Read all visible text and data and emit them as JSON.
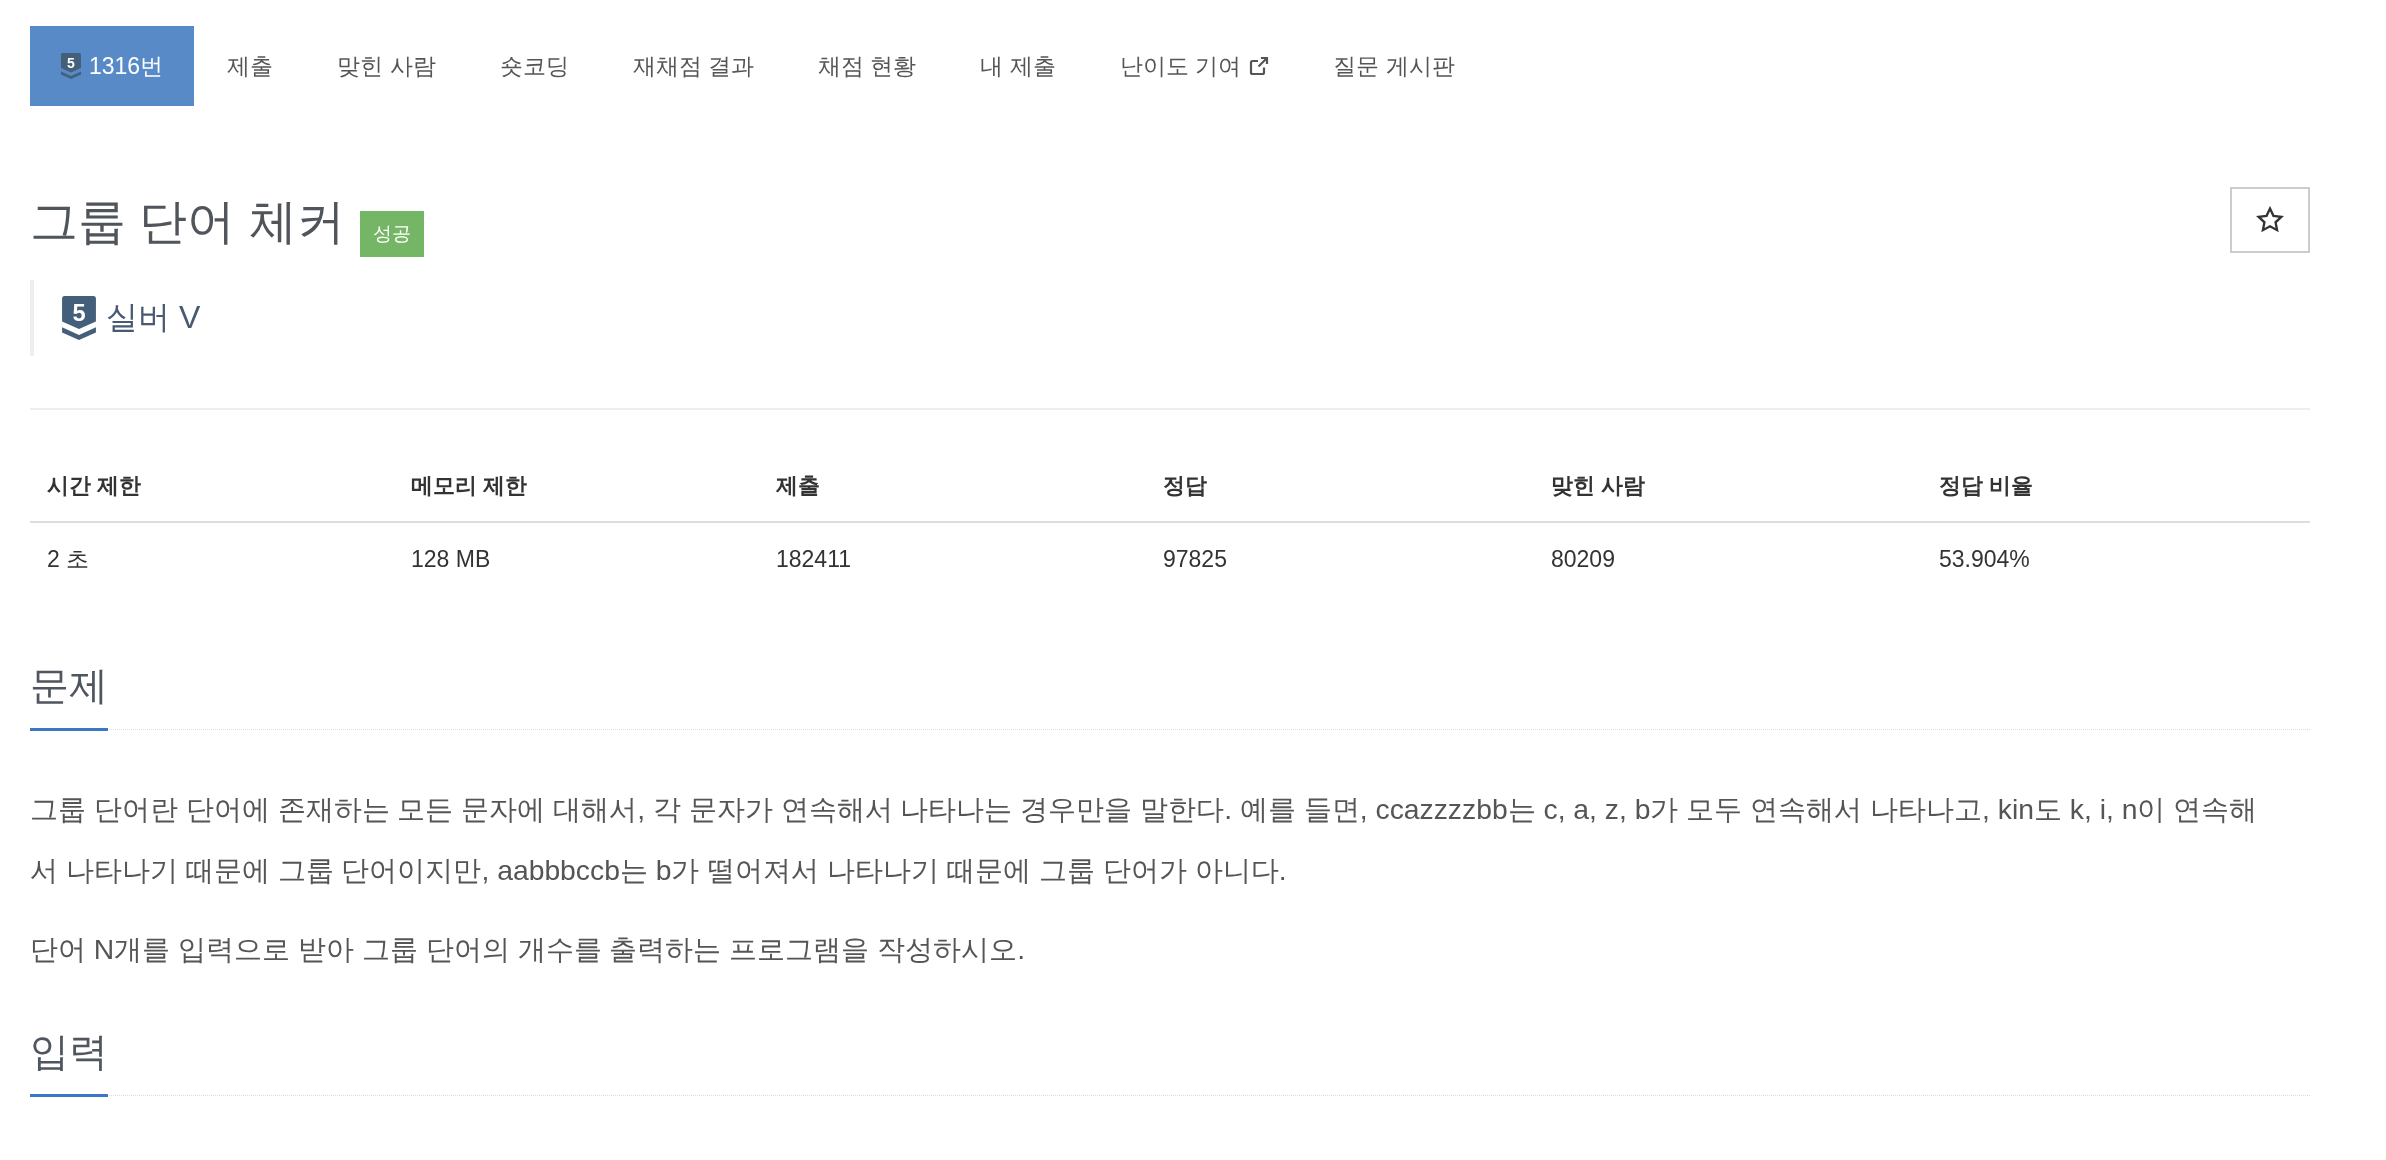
{
  "nav": {
    "tabs": [
      {
        "label": "1316번",
        "tier": "5",
        "external": false,
        "selected": true
      },
      {
        "label": "제출",
        "external": false,
        "selected": false
      },
      {
        "label": "맞힌 사람",
        "external": false,
        "selected": false
      },
      {
        "label": "숏코딩",
        "external": false,
        "selected": false
      },
      {
        "label": "재채점 결과",
        "external": false,
        "selected": false
      },
      {
        "label": "채점 현황",
        "external": false,
        "selected": false
      },
      {
        "label": "내 제출",
        "external": false,
        "selected": false
      },
      {
        "label": "난이도 기여",
        "external": true,
        "selected": false
      },
      {
        "label": "질문 게시판",
        "external": false,
        "selected": false
      }
    ]
  },
  "problem": {
    "title": "그룹 단어 체커",
    "result": {
      "label": "성공",
      "kind": "success"
    },
    "starred": false,
    "tier": {
      "level": "5",
      "name": "실버 V"
    }
  },
  "info_table": {
    "columns": [
      "시간 제한",
      "메모리 제한",
      "제출",
      "정답",
      "맞힌 사람",
      "정답 비율"
    ],
    "rows": [
      [
        "2 초",
        "128 MB",
        "182411",
        "97825",
        "80209",
        "53.904%"
      ]
    ]
  },
  "sections": [
    {
      "heading": "문제",
      "paragraphs": [
        "그룹 단어란 단어에 존재하는 모든 문자에 대해서, 각 문자가 연속해서 나타나는 경우만을 말한다. 예를 들면, ccazzzzbb는 c, a, z, b가 모두 연속해서 나타나고, kin도 k, i, n이 연속해서 나타나기 때문에 그룹 단어이지만, aabbbccb는 b가 떨어져서 나타나기 때문에 그룹 단어가 아니다.",
        "단어 N개를 입력으로 받아 그룹 단어의 개수를 출력하는 프로그램을 작성하시오."
      ]
    },
    {
      "heading": "입력"
    }
  ]
}
